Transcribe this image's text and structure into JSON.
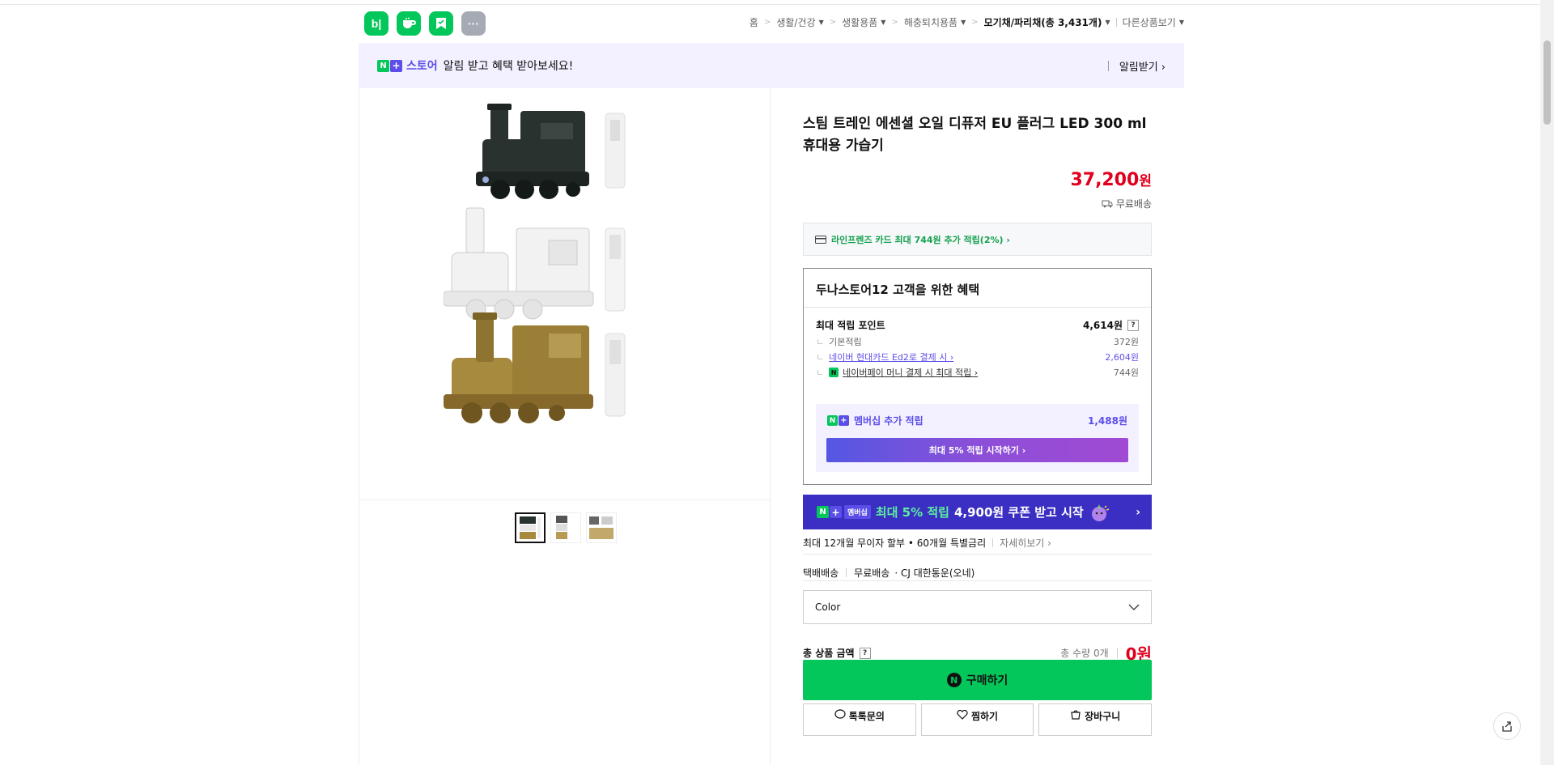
{
  "header": {
    "app_icons": [
      "blog-icon",
      "cafe-icon",
      "bookmark-icon",
      "more-icon"
    ],
    "blog_label": "b|",
    "more_label": "···"
  },
  "breadcrumb": {
    "items": [
      "홈",
      "생활/건강",
      "생활용품",
      "해충퇴치용품",
      "모기채/파리채(총 3,431개)"
    ],
    "other": "다른상품보기"
  },
  "banner": {
    "store": "스토어",
    "message": "알림 받고 혜택 받아보세요!",
    "action": "알림받기 ›"
  },
  "product": {
    "title": "스팀 트레인 에센셜 오일 디퓨저 EU 플러그 LED 300 ml 휴대용 가습기",
    "price": "37,200",
    "price_unit": "원",
    "shipping": "무료배송",
    "card_promo": "라인프렌즈 카드 최대 744원 추가 적립(2%) ›"
  },
  "benefit": {
    "title": "두나스토어12 고객을 위한 혜택",
    "max_points_label": "최대 적립 포인트",
    "max_points_value": "4,614원",
    "rows": [
      {
        "label": "기본적립",
        "value": "372원"
      },
      {
        "label": "네이버 현대카드 Ed2로 결제 시 ›",
        "value": "2,604원"
      },
      {
        "label": "네이버페이 머니 결제 시 최대 적립 ›",
        "value": "744원"
      }
    ],
    "membership_label": "멤버십 추가 적립",
    "membership_value": "1,488원",
    "membership_button": "최대 5% 적립 시작하기 ›"
  },
  "promo_banner": {
    "badge": "멤버십",
    "text_green": "최대 5% 적립",
    "text_white": "4,900원 쿠폰 받고 시작"
  },
  "installment": {
    "text": "최대 12개월 무이자 할부 • 60개월 특별금리",
    "link": "자세히보기 ›"
  },
  "delivery": {
    "type": "택배배송",
    "fee": "무료배송",
    "carrier": "· CJ 대한통운(오네)"
  },
  "option_select": {
    "placeholder": "Color"
  },
  "total": {
    "label": "총 상품 금액",
    "qty": "총 수량 0개",
    "amount": "0원"
  },
  "buttons": {
    "buy": "구매하기",
    "talk": "톡톡문의",
    "wish": "찜하기",
    "cart": "장바구니"
  },
  "colors": {
    "naver_green": "#03c75a",
    "price_red": "#e0001d",
    "membership_purple": "#5b4ee8"
  }
}
